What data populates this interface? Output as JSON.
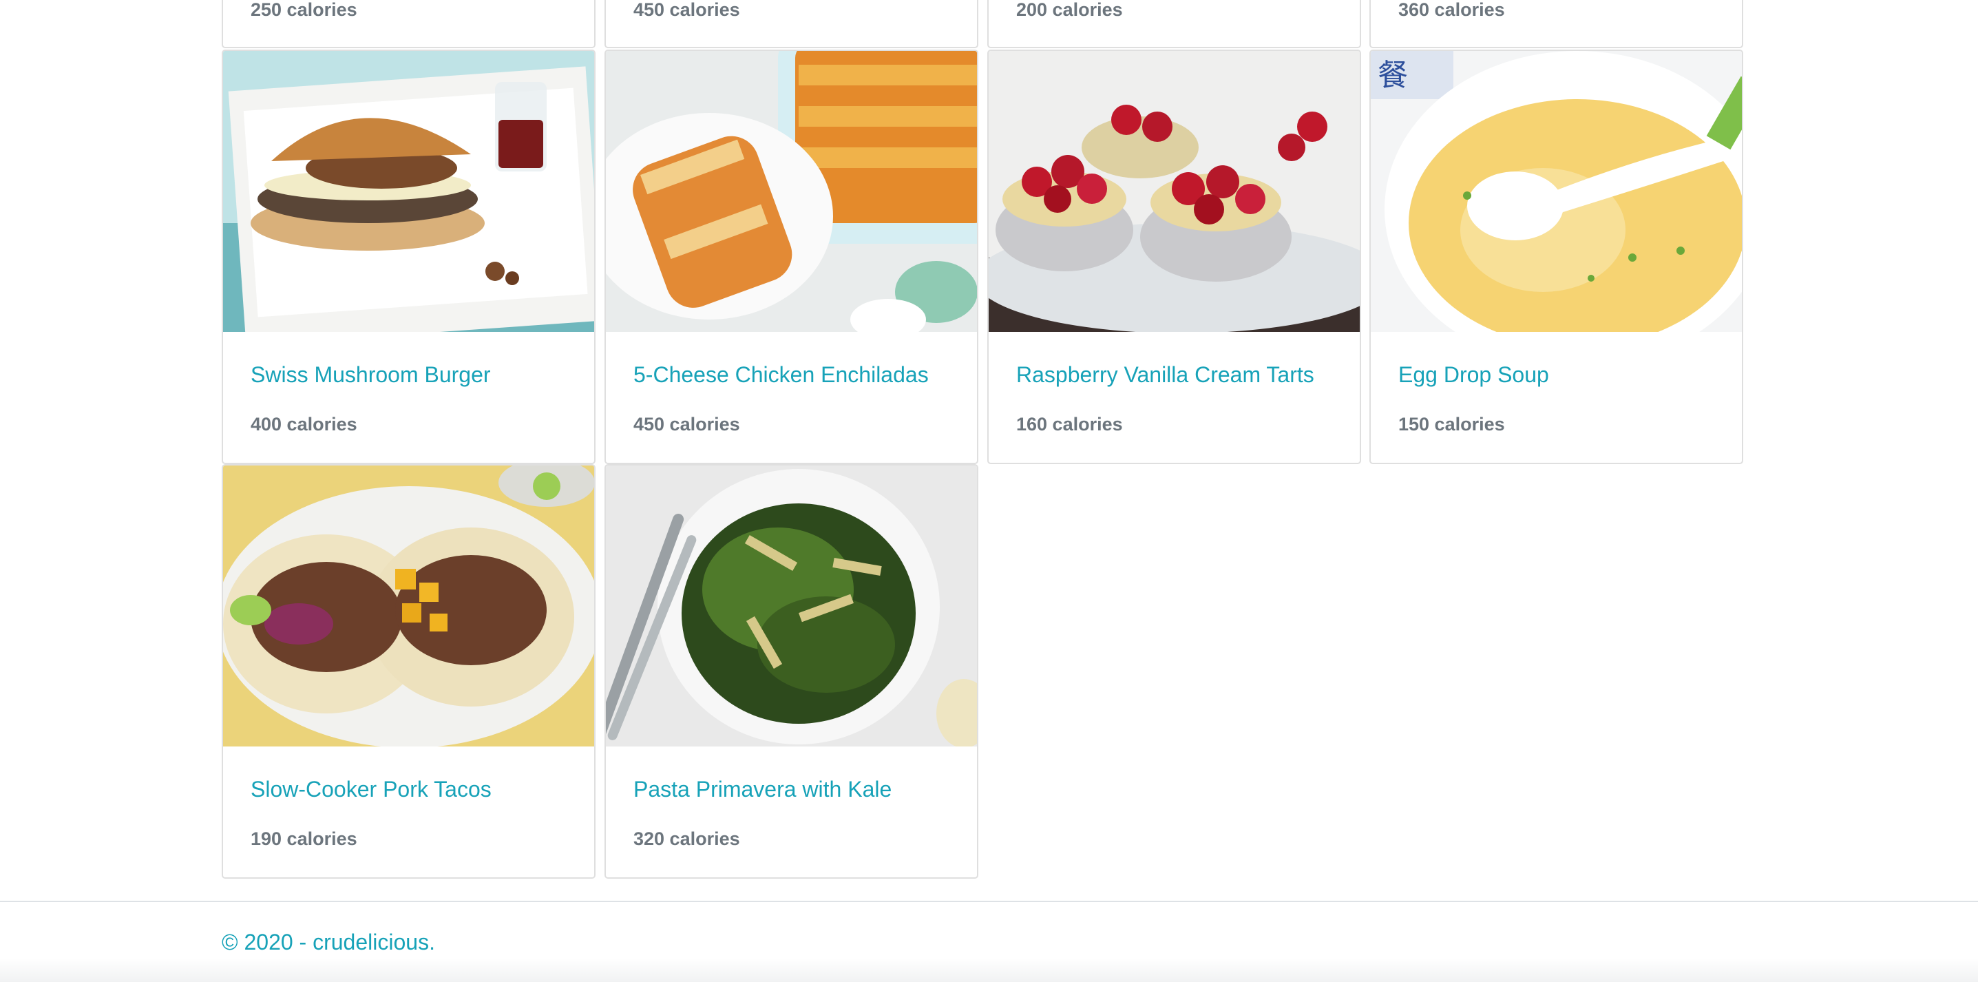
{
  "top_row": [
    {
      "calories": "250 calories"
    },
    {
      "calories": "450 calories"
    },
    {
      "calories": "200 calories"
    },
    {
      "calories": "360 calories"
    }
  ],
  "recipes": [
    {
      "title": "Swiss Mushroom Burger",
      "calories": "400 calories"
    },
    {
      "title": "5-Cheese Chicken Enchiladas",
      "calories": "450 calories"
    },
    {
      "title": "Raspberry Vanilla Cream Tarts",
      "calories": "160 calories"
    },
    {
      "title": "Egg Drop Soup",
      "calories": "150 calories"
    },
    {
      "title": "Slow-Cooker Pork Tacos",
      "calories": "190 calories"
    },
    {
      "title": "Pasta Primavera with Kale",
      "calories": "320 calories"
    }
  ],
  "footer": {
    "prefix": "© 2020 - ",
    "link": "crudelicious."
  }
}
